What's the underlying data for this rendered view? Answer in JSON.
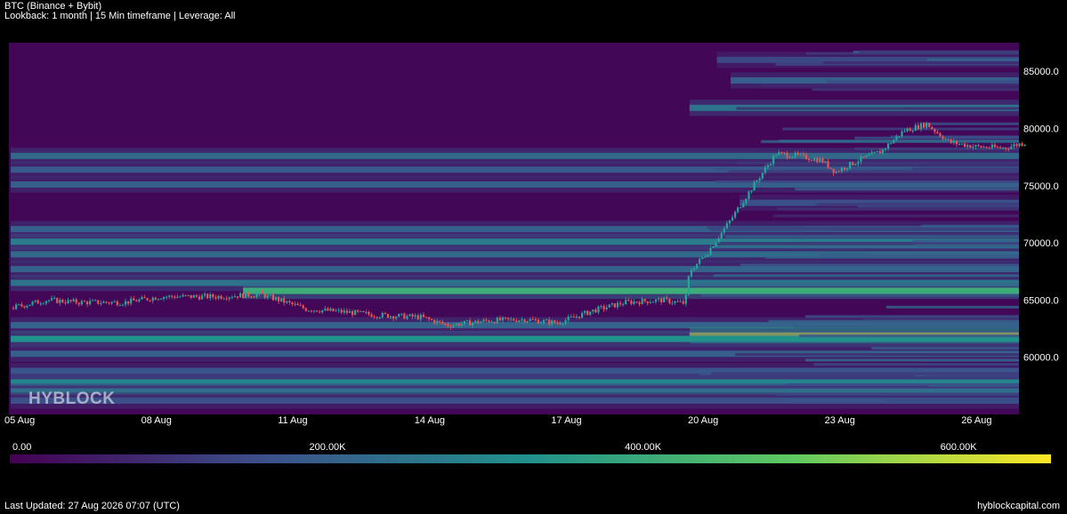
{
  "header": {
    "title": "BTC (Binance + Bybit)",
    "subtitle": "Lookback: 1 month | 15 Min timeframe | Leverage: All"
  },
  "watermark": "HYBLOCK",
  "footer": {
    "updated": "Last Updated: 27 Aug 2026 07:07 (UTC)",
    "site": "hyblockcapital.com"
  },
  "colors": {
    "background": "#000000",
    "heatmap_low": "#440154",
    "heatmap_mid": "#21918c",
    "heatmap_high": "#fde725",
    "candle_up": "#26a69a",
    "candle_down": "#ef5350"
  },
  "chart_data": {
    "type": "heatmap",
    "title": "",
    "x_tick_labels": [
      "05 Aug",
      "08 Aug",
      "11 Aug",
      "14 Aug",
      "17 Aug",
      "20 Aug",
      "23 Aug",
      "26 Aug"
    ],
    "x_ticks_day": [
      0,
      3,
      6,
      9,
      12,
      15,
      18,
      21
    ],
    "x_range_days": [
      0,
      22.3
    ],
    "y_tick_labels": [
      "60000.0",
      "65000.0",
      "70000.0",
      "75000.0",
      "80000.0",
      "85000.0"
    ],
    "y_ticks": [
      60000,
      65000,
      70000,
      75000,
      80000,
      85000
    ],
    "ylim": [
      55000,
      87500
    ],
    "price_path": {
      "day": [
        0,
        0.8,
        1.5,
        2.5,
        3.3,
        4.5,
        5.5,
        6.5,
        7.2,
        8,
        9,
        9.6,
        10.5,
        11.3,
        12,
        12.8,
        13.5,
        14.3,
        14.8,
        14.9,
        15.3,
        15.8,
        16.3,
        16.8,
        17.3,
        17.8,
        18.1,
        18.6,
        19.1,
        19.6,
        20.1,
        20.6,
        21.2,
        21.8,
        22.3
      ],
      "price": [
        64300,
        65000,
        64800,
        64800,
        65300,
        65300,
        65500,
        64200,
        64000,
        63700,
        63500,
        62800,
        63200,
        63300,
        63000,
        64100,
        64800,
        65000,
        64700,
        67500,
        69200,
        72000,
        75000,
        77800,
        77600,
        77200,
        76200,
        77200,
        78000,
        79800,
        80400,
        78800,
        78400,
        78300,
        78800
      ]
    },
    "liquidity_levels": [
      {
        "price": 86000,
        "intensity": 0.22,
        "from_day": 15.5
      },
      {
        "price": 84200,
        "intensity": 0.3,
        "from_day": 15.8
      },
      {
        "price": 81800,
        "intensity": 0.38,
        "from_day": 14.9
      },
      {
        "price": 77600,
        "intensity": 0.34,
        "from_day": 0
      },
      {
        "price": 76400,
        "intensity": 0.28,
        "from_day": 0
      },
      {
        "price": 75100,
        "intensity": 0.3,
        "from_day": 0
      },
      {
        "price": 73500,
        "intensity": 0.24,
        "from_day": 16.0
      },
      {
        "price": 71200,
        "intensity": 0.3,
        "from_day": 0
      },
      {
        "price": 70100,
        "intensity": 0.42,
        "from_day": 0
      },
      {
        "price": 69000,
        "intensity": 0.34,
        "from_day": 0
      },
      {
        "price": 67700,
        "intensity": 0.32,
        "from_day": 0
      },
      {
        "price": 66500,
        "intensity": 0.38,
        "from_day": 0
      },
      {
        "price": 65800,
        "intensity": 0.62,
        "from_day": 5.1
      },
      {
        "price": 62800,
        "intensity": 0.32,
        "from_day": 0
      },
      {
        "price": 61900,
        "intensity": 0.95,
        "from_day": 14.9
      },
      {
        "price": 61600,
        "intensity": 0.5,
        "from_day": 0
      },
      {
        "price": 60300,
        "intensity": 0.3,
        "from_day": 0
      },
      {
        "price": 58800,
        "intensity": 0.26,
        "from_day": 0
      },
      {
        "price": 57800,
        "intensity": 0.45,
        "from_day": 0
      },
      {
        "price": 57000,
        "intensity": 0.36,
        "from_day": 0
      },
      {
        "price": 56200,
        "intensity": 0.24,
        "from_day": 0
      }
    ],
    "colorbar": {
      "tick_labels": [
        "0.00",
        "200.00K",
        "400.00K",
        "600.00K"
      ],
      "ticks": [
        0,
        200000,
        400000,
        600000
      ],
      "range": [
        0,
        660000
      ]
    }
  }
}
